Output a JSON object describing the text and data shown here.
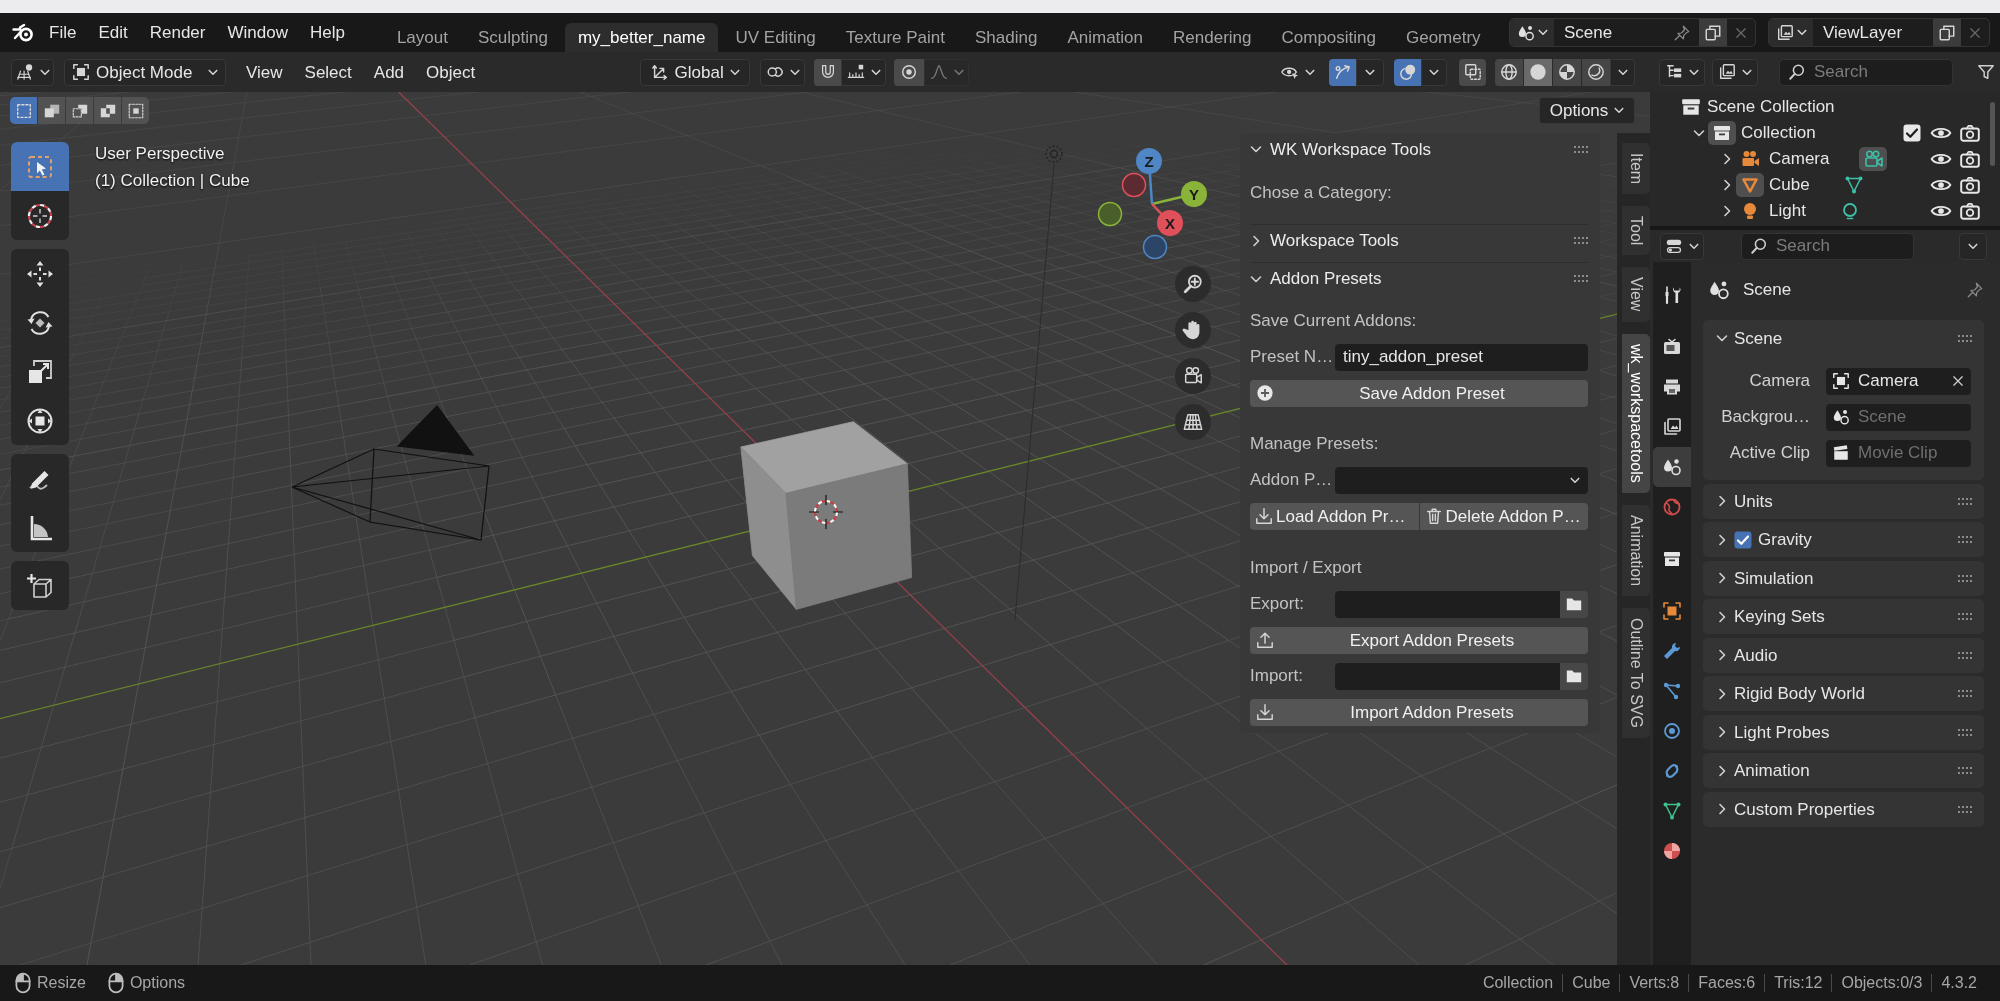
{
  "topbar": {
    "menus": [
      "File",
      "Edit",
      "Render",
      "Window",
      "Help"
    ],
    "workspaces": [
      {
        "label": "Layout",
        "selected": false
      },
      {
        "label": "Sculpting",
        "selected": false
      },
      {
        "label": "my_better_name",
        "selected": true
      },
      {
        "label": "UV Editing",
        "selected": false
      },
      {
        "label": "Texture Paint",
        "selected": false
      },
      {
        "label": "Shading",
        "selected": false
      },
      {
        "label": "Animation",
        "selected": false
      },
      {
        "label": "Rendering",
        "selected": false
      },
      {
        "label": "Compositing",
        "selected": false
      },
      {
        "label": "Geometry",
        "selected": false
      }
    ],
    "scene": {
      "name": "Scene"
    },
    "view_layer": {
      "name": "ViewLayer"
    }
  },
  "viewport_header": {
    "mode": "Object Mode",
    "menus": [
      "View",
      "Select",
      "Add",
      "Object"
    ],
    "orientation": "Global",
    "snap": {
      "on": false
    },
    "proportional": {
      "on": false
    },
    "gizmos": {
      "on": true
    },
    "overlays": {
      "on": true
    },
    "xray": {
      "on": false
    },
    "shading": [
      {
        "kind": "wireframe",
        "selected": false
      },
      {
        "kind": "solid",
        "selected": true
      },
      {
        "kind": "material",
        "selected": false
      },
      {
        "kind": "rendered",
        "selected": false
      }
    ]
  },
  "viewport": {
    "select_modes": [
      {
        "kind": "set",
        "selected": true
      },
      {
        "kind": "extend",
        "selected": false
      },
      {
        "kind": "subtract",
        "selected": false
      },
      {
        "kind": "difference",
        "selected": false
      },
      {
        "kind": "intersect",
        "selected": false
      }
    ],
    "toolbar": [
      [
        {
          "kind": "select_box",
          "selected": true
        },
        {
          "kind": "cursor",
          "selected": false
        }
      ],
      [
        {
          "kind": "move",
          "selected": false
        },
        {
          "kind": "rotate",
          "selected": false
        },
        {
          "kind": "scale",
          "selected": false
        },
        {
          "kind": "transform",
          "selected": false
        }
      ],
      [
        {
          "kind": "annotate",
          "selected": false
        },
        {
          "kind": "measure",
          "selected": false
        }
      ],
      [
        {
          "kind": "add_cube",
          "selected": false
        }
      ]
    ],
    "view_name": "User Perspective",
    "context": "(1) Collection | Cube",
    "gizmo_axes": [
      "X",
      "Y",
      "Z"
    ],
    "options_button": "Options"
  },
  "sidebar": {
    "tabs": [
      {
        "label": "Item",
        "selected": false
      },
      {
        "label": "Tool",
        "selected": false
      },
      {
        "label": "View",
        "selected": false
      },
      {
        "label": "wk_workspacetools",
        "selected": true
      },
      {
        "label": "Animation",
        "selected": false
      },
      {
        "label": "Outline To SVG",
        "selected": false
      }
    ],
    "panel": {
      "title": "WK Workspace Tools",
      "expanded": true,
      "category_label": "Chose a Category:",
      "workspace_tools": {
        "title": "Workspace Tools",
        "expanded": false
      },
      "addon_presets": {
        "title": "Addon Presets",
        "expanded": true,
        "save_label": "Save Current Addons:",
        "preset_name": {
          "label": "Preset N…",
          "value": "tiny_addon_preset"
        },
        "save_button": "Save Addon Preset",
        "manage_label": "Manage Presets:",
        "preset_select": {
          "label": "Addon P…"
        },
        "load_button": "Load Addon Pr…",
        "delete_button": "Delete Addon P…",
        "io_label": "Import / Export",
        "export_path": {
          "label": "Export:"
        },
        "export_button": "Export Addon Presets",
        "import_path": {
          "label": "Import:"
        },
        "import_button": "Import Addon Presets"
      }
    }
  },
  "outliner": {
    "search": {
      "placeholder": "Search"
    },
    "tree": [
      {
        "kind": "scene_collection",
        "name": "Scene Collection",
        "children": [
          {
            "kind": "collection",
            "name": "Collection",
            "expanded": true,
            "active": true,
            "checked": true,
            "visible": true,
            "renderable": true,
            "children": [
              {
                "kind": "camera",
                "name": "Camera",
                "expanded": false,
                "active": false,
                "data_active": true,
                "visible": true,
                "renderable": true
              },
              {
                "kind": "mesh",
                "name": "Cube",
                "expanded": false,
                "active": true,
                "data_active": false,
                "visible": true,
                "renderable": true
              },
              {
                "kind": "light",
                "name": "Light",
                "expanded": false,
                "active": false,
                "data_active": false,
                "visible": true,
                "renderable": true
              }
            ]
          }
        ]
      }
    ]
  },
  "properties": {
    "search": {
      "placeholder": "Search"
    },
    "tab_groups": [
      [
        {
          "kind": "tool",
          "selected": false
        }
      ],
      [
        {
          "kind": "render",
          "selected": false
        },
        {
          "kind": "output",
          "selected": false
        },
        {
          "kind": "view_layer",
          "selected": false
        },
        {
          "kind": "scene",
          "selected": true
        },
        {
          "kind": "world",
          "selected": false
        }
      ],
      [
        {
          "kind": "collection",
          "selected": false
        }
      ],
      [
        {
          "kind": "object",
          "selected": false
        },
        {
          "kind": "modifiers",
          "selected": false
        },
        {
          "kind": "particles",
          "selected": false
        },
        {
          "kind": "physics",
          "selected": false
        },
        {
          "kind": "constraints",
          "selected": false
        },
        {
          "kind": "data",
          "selected": false
        },
        {
          "kind": "material",
          "selected": false
        }
      ]
    ],
    "context": "Scene",
    "panels": [
      {
        "kind": "fields",
        "title": "Scene",
        "expanded": true,
        "fields": [
          {
            "kind": "camera",
            "label": "Camera",
            "value": "Camera"
          },
          {
            "kind": "scene",
            "label": "Backgrou…",
            "placeholder": "Scene"
          },
          {
            "kind": "clip",
            "label": "Active Clip",
            "placeholder": "Movie Clip"
          }
        ]
      },
      {
        "kind": "plain",
        "title": "Units",
        "expanded": false
      },
      {
        "kind": "toggle",
        "title": "Gravity",
        "expanded": false,
        "checked": true
      },
      {
        "kind": "plain",
        "title": "Simulation",
        "expanded": false
      },
      {
        "kind": "plain",
        "title": "Keying Sets",
        "expanded": false
      },
      {
        "kind": "plain",
        "title": "Audio",
        "expanded": false
      },
      {
        "kind": "plain",
        "title": "Rigid Body World",
        "expanded": false
      },
      {
        "kind": "plain",
        "title": "Light Probes",
        "expanded": false
      },
      {
        "kind": "plain",
        "title": "Animation",
        "expanded": false
      },
      {
        "kind": "plain",
        "title": "Custom Properties",
        "expanded": false
      }
    ]
  },
  "status_bar": {
    "hints": [
      {
        "kind": "mouse_left",
        "label": "Resize"
      },
      {
        "kind": "mouse_right",
        "label": "Options"
      }
    ],
    "stats": [
      "Collection",
      "Cube",
      "Verts:8",
      "Faces:6",
      "Tris:12",
      "Objects:0/3",
      "4.3.2"
    ]
  }
}
